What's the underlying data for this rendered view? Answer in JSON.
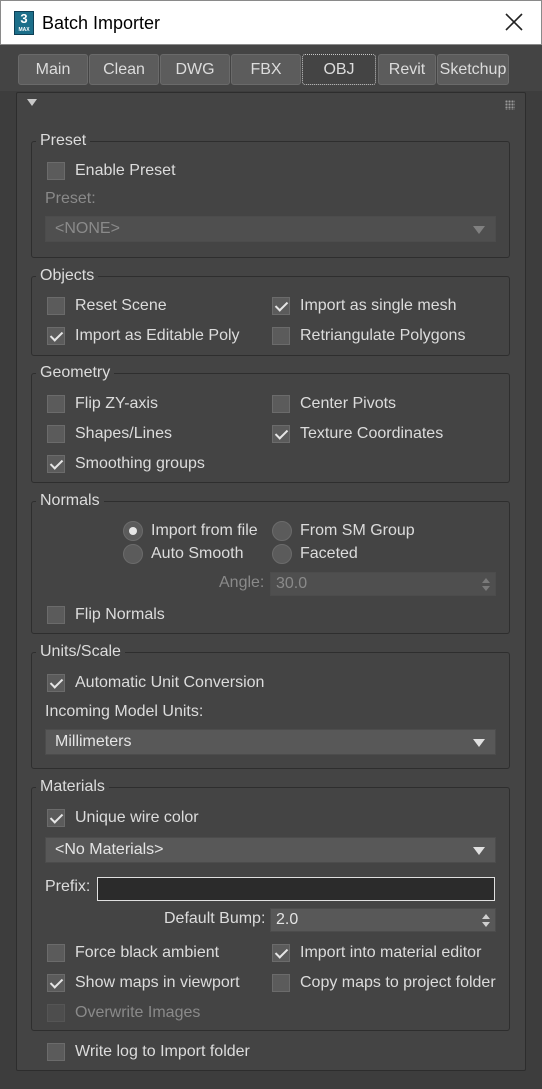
{
  "window": {
    "title": "Batch Importer",
    "app_icon": {
      "number": "3",
      "sub": "MAX"
    }
  },
  "tabs": [
    {
      "label": "Main",
      "active": false
    },
    {
      "label": "Clean",
      "active": false
    },
    {
      "label": "DWG",
      "active": false
    },
    {
      "label": "FBX",
      "active": false
    },
    {
      "label": "OBJ",
      "active": true
    },
    {
      "label": "Revit",
      "active": false
    },
    {
      "label": "Sketchup",
      "active": false
    }
  ],
  "preset": {
    "title": "Preset",
    "enable_label": "Enable Preset",
    "enable_checked": false,
    "preset_label": "Preset:",
    "preset_value": "<NONE>"
  },
  "objects": {
    "title": "Objects",
    "reset_scene": {
      "label": "Reset Scene",
      "checked": false
    },
    "import_single_mesh": {
      "label": "Import as single mesh",
      "checked": true
    },
    "import_editable_poly": {
      "label": "Import as Editable Poly",
      "checked": true
    },
    "retriangulate": {
      "label": "Retriangulate Polygons",
      "checked": false
    }
  },
  "geometry": {
    "title": "Geometry",
    "flip_zy": {
      "label": "Flip ZY-axis",
      "checked": false
    },
    "center_pivots": {
      "label": "Center Pivots",
      "checked": false
    },
    "shapes_lines": {
      "label": "Shapes/Lines",
      "checked": false
    },
    "texture_coords": {
      "label": "Texture Coordinates",
      "checked": true
    },
    "smoothing_groups": {
      "label": "Smoothing groups",
      "checked": true
    }
  },
  "normals": {
    "title": "Normals",
    "import_from_file": "Import from file",
    "from_sm_group": "From SM Group",
    "auto_smooth": "Auto Smooth",
    "faceted": "Faceted",
    "selected": "import_from_file",
    "angle_label": "Angle:",
    "angle_value": "30.0",
    "flip_normals": {
      "label": "Flip Normals",
      "checked": false
    }
  },
  "units": {
    "title": "Units/Scale",
    "auto_conversion": {
      "label": "Automatic Unit Conversion",
      "checked": true
    },
    "incoming_label": "Incoming Model Units:",
    "incoming_value": "Millimeters"
  },
  "materials": {
    "title": "Materials",
    "unique_wire": {
      "label": "Unique wire color",
      "checked": true
    },
    "materials_value": "<No Materials>",
    "prefix_label": "Prefix:",
    "prefix_value": "",
    "default_bump_label": "Default Bump:",
    "default_bump_value": "2.0",
    "force_black": {
      "label": "Force black ambient",
      "checked": false
    },
    "import_into_editor": {
      "label": "Import into material editor",
      "checked": true
    },
    "show_maps": {
      "label": "Show maps in viewport",
      "checked": true
    },
    "copy_maps": {
      "label": "Copy maps to project folder",
      "checked": false
    },
    "overwrite_images": {
      "label": "Overwrite Images",
      "checked": false
    }
  },
  "write_log": {
    "label": "Write log to Import folder",
    "checked": false
  },
  "icons": [
    "app-icon",
    "close-icon",
    "rollup-arrow-icon",
    "grip-icon",
    "dropdown-arrow-icon",
    "spinner-arrows-icon"
  ]
}
